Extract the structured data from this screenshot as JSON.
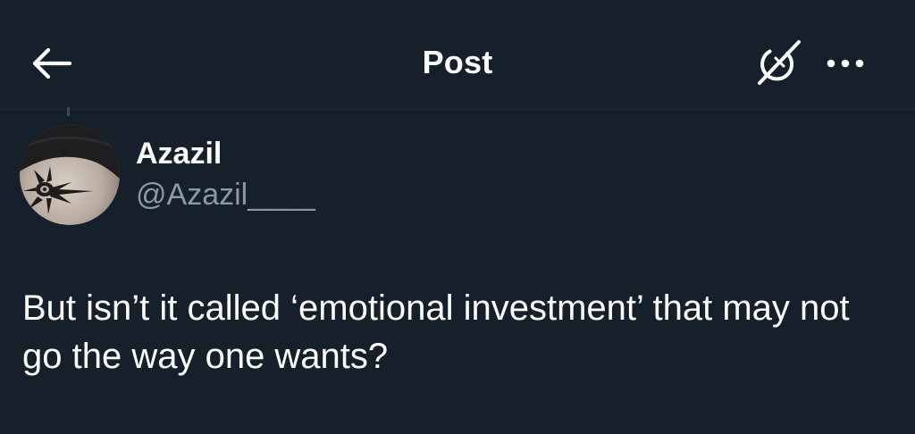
{
  "header": {
    "title": "Post",
    "back_icon": "arrow-left-icon",
    "grok_icon": "grok-icon",
    "more_icon": "more-horizontal-icon"
  },
  "author": {
    "display_name": "Azazil",
    "handle": "@Azazil____",
    "avatar_icon": "avatar-tattoo-photo"
  },
  "post": {
    "text": "But isn’t it called ‘emotional investment’ that may not go the way one wants?"
  },
  "colors": {
    "background": "#15202b",
    "text_primary": "#ffffff",
    "text_secondary": "#8b98a5"
  }
}
